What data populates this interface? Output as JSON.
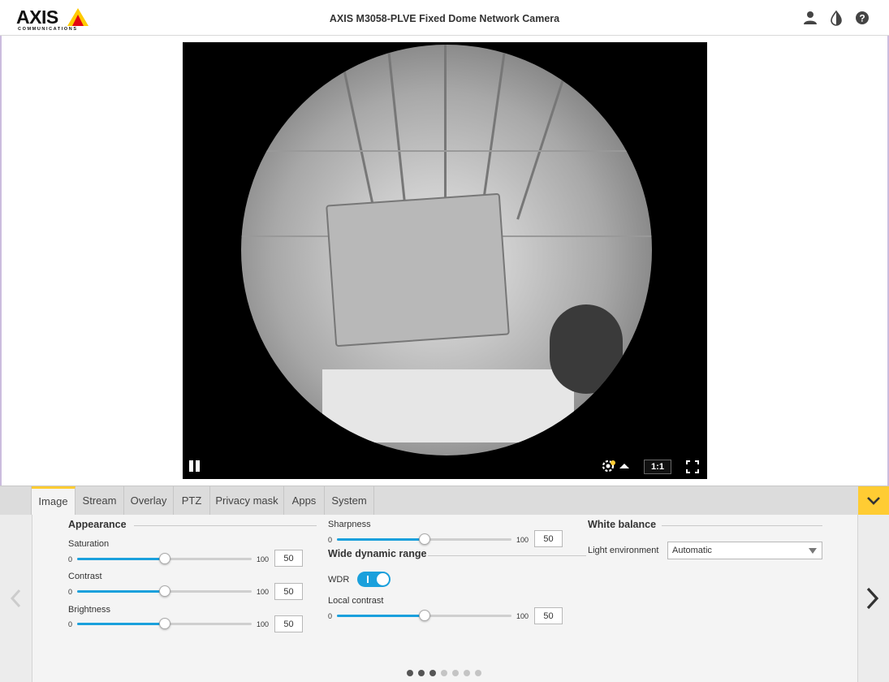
{
  "header": {
    "logo_text": "AXIS",
    "logo_sub": "COMMUNICATIONS",
    "title": "AXIS M3058-PLVE Fixed Dome Network Camera",
    "icons": [
      "user-icon",
      "contrast-icon",
      "help-icon"
    ]
  },
  "video": {
    "ratio_label": "1:1",
    "controls": [
      "pause-icon",
      "stream-settings-icon",
      "fullscreen-icon"
    ]
  },
  "tabs": [
    {
      "label": "Image",
      "active": true
    },
    {
      "label": "Stream"
    },
    {
      "label": "Overlay"
    },
    {
      "label": "PTZ"
    },
    {
      "label": "Privacy mask"
    },
    {
      "label": "Apps"
    },
    {
      "label": "System"
    }
  ],
  "appearance": {
    "title": "Appearance",
    "saturation": {
      "label": "Saturation",
      "min": "0",
      "max": "100",
      "value": "50"
    },
    "contrast": {
      "label": "Contrast",
      "min": "0",
      "max": "100",
      "value": "50"
    },
    "brightness": {
      "label": "Brightness",
      "min": "0",
      "max": "100",
      "value": "50"
    }
  },
  "sharpness": {
    "label": "Sharpness",
    "min": "0",
    "max": "100",
    "value": "50"
  },
  "wdr_section": {
    "title": "Wide dynamic range",
    "wdr_label": "WDR",
    "wdr_on": true,
    "local_contrast": {
      "label": "Local contrast",
      "min": "0",
      "max": "100",
      "value": "50"
    }
  },
  "white_balance": {
    "title": "White balance",
    "light_env_label": "Light environment",
    "light_env_value": "Automatic"
  },
  "pagination": {
    "count": 7,
    "active": [
      0,
      1,
      2
    ]
  },
  "colors": {
    "accent": "#1aa0dc",
    "brand": "#ffcc33"
  }
}
